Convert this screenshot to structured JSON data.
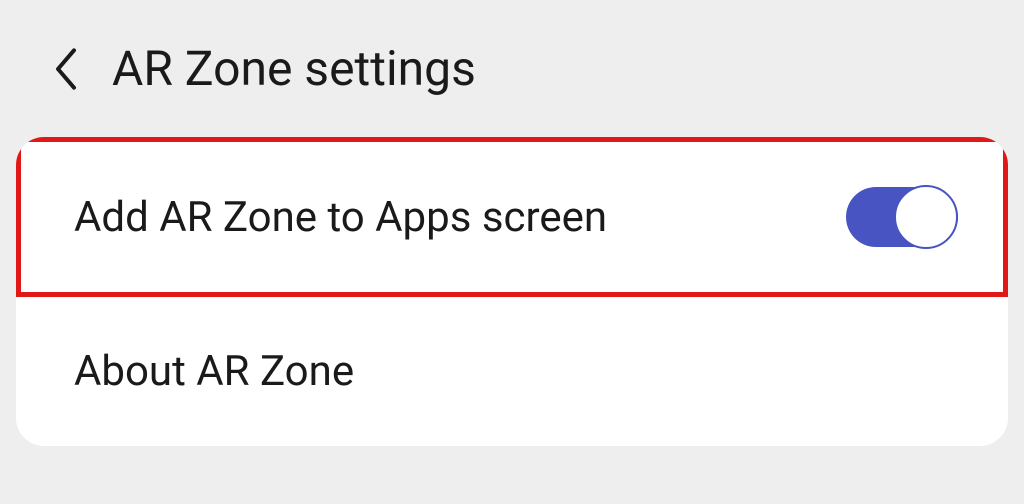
{
  "header": {
    "title": "AR Zone settings"
  },
  "settings": {
    "addToApps": {
      "label": "Add AR Zone to Apps screen",
      "enabled": true
    },
    "about": {
      "label": "About AR Zone"
    }
  }
}
